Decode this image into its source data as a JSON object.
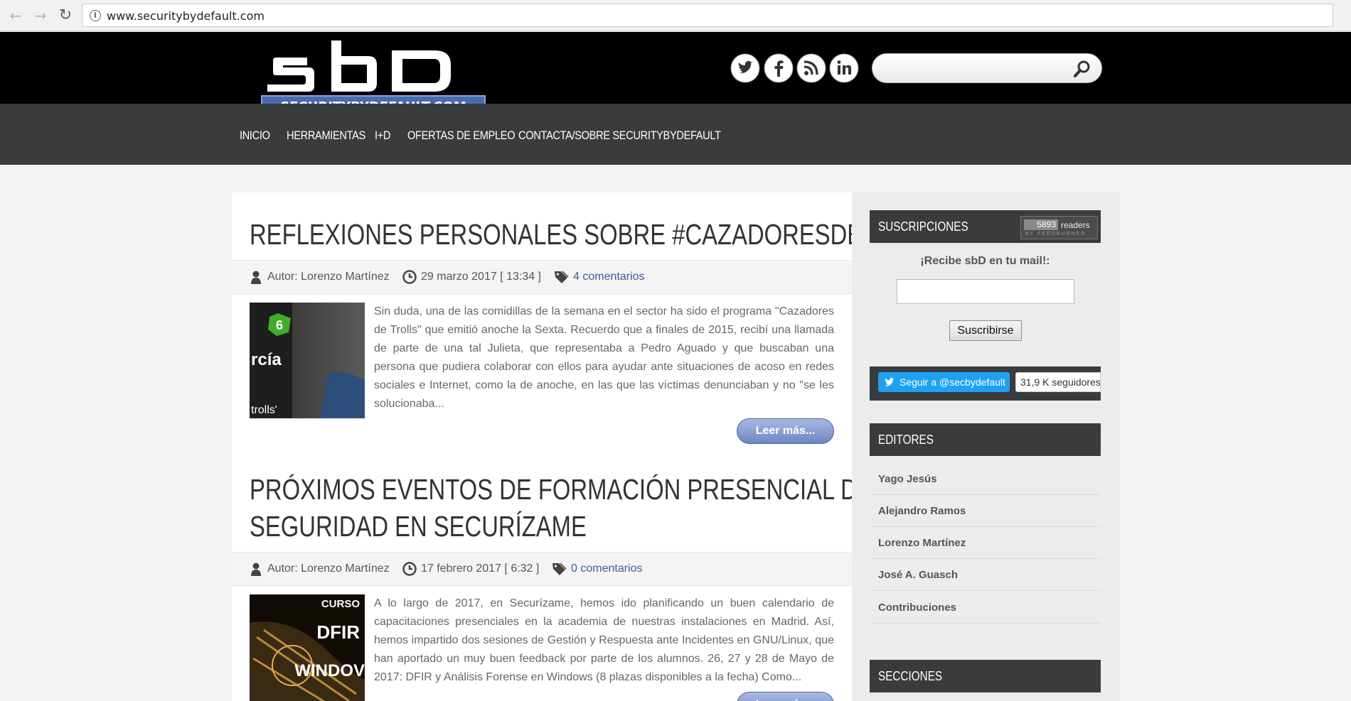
{
  "browser": {
    "url": "www.securitybydefault.com",
    "back_icon": "back-arrow-icon",
    "forward_icon": "forward-arrow-icon",
    "reload_icon": "reload-icon"
  },
  "header": {
    "logo_text": "sbD",
    "logo_subtext": "SECURITYBYDEFAULT.COM",
    "social": [
      "twitter-icon",
      "facebook-icon",
      "rss-icon",
      "linkedin-icon"
    ],
    "search_placeholder": ""
  },
  "nav": {
    "items": [
      "INICIO",
      "HERRAMIENTAS",
      "I+D",
      "OFERTAS DE EMPLEO",
      "CONTACTA/SOBRE SECURITYBYDEFAULT"
    ]
  },
  "posts": [
    {
      "title_lines": [
        "REFLEXIONES PERSONALES SOBRE #CAZADORESDETROLLS"
      ],
      "author": "Autor: Lorenzo Martínez",
      "date": "29 marzo 2017 [ 13:34 ]",
      "comments": "4 comentarios",
      "thumb_text_1": "rcía",
      "thumb_text_2": "trolls'",
      "excerpt": "Sin duda, una de las comidillas de la semana en el sector ha sido el programa \"Cazadores de Trolls\" que emitió anoche la Sexta. Recuerdo que a finales de 2015, recibí una llamada de parte de una tal Julieta, que representaba a Pedro Aguado y que buscaban una persona que pudiera colaborar con ellos para ayudar ante situaciones de acoso en redes sociales e Internet, como la de anoche, en las que las víctimas denunciaban y no \"se les solucionaba...",
      "read_more": "Leer más..."
    },
    {
      "title_lines": [
        "PRÓXIMOS EVENTOS DE FORMACIÓN PRESENCIAL DE",
        "SEGURIDAD EN SECURÍZAME"
      ],
      "author": "Autor: Lorenzo Martínez",
      "date": "17 febrero 2017 [ 6:32 ]",
      "comments": "0 comentarios",
      "thumb_text_1": "CURSO",
      "thumb_text_2": "DFIR",
      "thumb_text_3": "WINDOV",
      "excerpt": "A lo largo de 2017, en Securízame, hemos ido planificando un buen calendario de capacitaciones presenciales en la academia de nuestras instalaciones en Madrid. Así, hemos impartido dos sesiones de Gestión y Respuesta ante Incidentes en GNU/Linux, que han aportado un muy buen feedback por parte de los alumnos.   26, 27 y 28 de Mayo de 2017: DFIR y Análisis Forense en Windows (8 plazas disponibles a la fecha)  Como...",
      "read_more": "Leer más..."
    }
  ],
  "sidebar": {
    "subscriptions_title": "SUSCRIPCIONES",
    "feedburner_count": "5893",
    "feedburner_label": "readers",
    "feedburner_sub": "BY FEEDBURNER",
    "subscribe_label": "¡Recibe sbD en tu mail!:",
    "email_value": "",
    "subscribe_button": "Suscribirse",
    "twitter_follow": "Seguir a @secbydefault",
    "twitter_count": "31,9 K seguidores",
    "editors_title": "EDITORES",
    "editors": [
      "Yago Jesús",
      "Alejandro Ramos",
      "Lorenzo Martínez",
      "José A. Guasch",
      "Contribuciones"
    ],
    "sections_title": "SECCIONES"
  },
  "colors": {
    "header_bg": "#000000",
    "nav_bg": "#3a3b3d",
    "link": "#3b5d9a",
    "button": "#6e86c4"
  }
}
